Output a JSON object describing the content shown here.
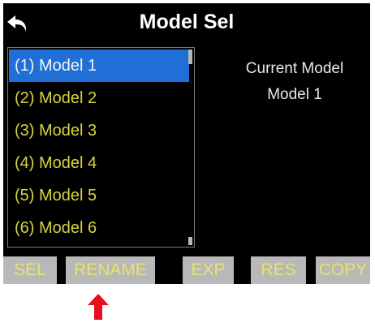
{
  "header": {
    "title": "Model Sel",
    "back_icon": "back-arrow-icon"
  },
  "model_list": {
    "items": [
      {
        "label": "(1) Model 1",
        "selected": true
      },
      {
        "label": "(2) Model 2",
        "selected": false
      },
      {
        "label": "(3) Model 3",
        "selected": false
      },
      {
        "label": "(4) Model 4",
        "selected": false
      },
      {
        "label": "(5) Model 5",
        "selected": false
      },
      {
        "label": "(6) Model 6",
        "selected": false
      }
    ]
  },
  "current": {
    "label": "Current Model",
    "value": "Model 1"
  },
  "buttons": {
    "sel": "SEL",
    "rename": "RENAME",
    "exp": "EXP",
    "res": "RES",
    "copy": "COPY"
  },
  "annotation": {
    "icon": "up-arrow-icon",
    "color": "#e8101f"
  },
  "colors": {
    "background": "#000000",
    "highlight": "#1f6fd6",
    "item_text": "#d6d43c",
    "button_bg": "#b8b8b8",
    "button_text": "#e6e46a"
  }
}
